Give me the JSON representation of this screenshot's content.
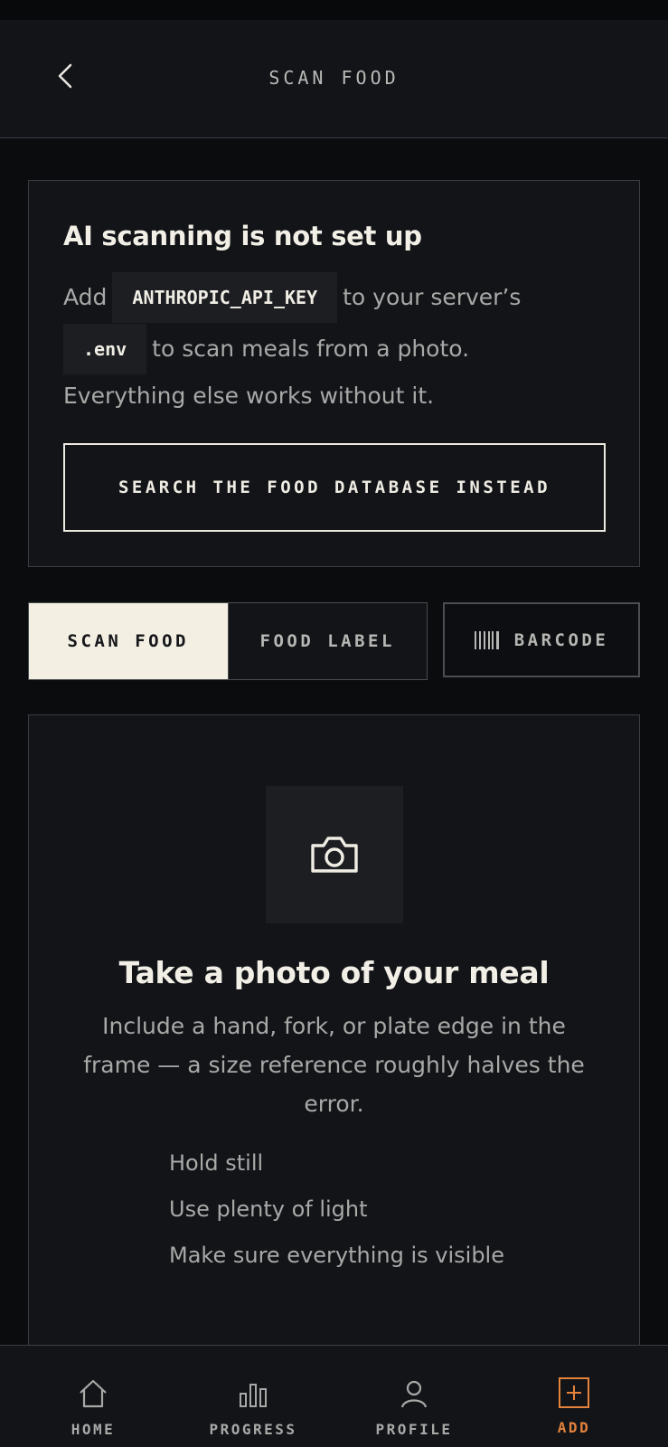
{
  "header": {
    "title": "SCAN FOOD"
  },
  "notice": {
    "title": "AI scanning is not set up",
    "add_word": "Add",
    "api_key_code": "ANTHROPIC_API_KEY",
    "after_key": "to your server’s",
    "env_code": ".env",
    "after_env": "to scan meals from a photo.",
    "line3": "Everything else works without it.",
    "button_label": "SEARCH THE FOOD DATABASE INSTEAD"
  },
  "modes": {
    "scan_food": "SCAN FOOD",
    "food_label": "FOOD LABEL",
    "barcode": "BARCODE"
  },
  "photo": {
    "title": "Take a photo of your meal",
    "subtitle": "Include a hand, fork, or plate edge in the frame — a size reference roughly halves the error.",
    "tips": [
      "Hold still",
      "Use plenty of light",
      "Make sure everything is visible"
    ]
  },
  "nav": {
    "home": "HOME",
    "progress": "PROGRESS",
    "profile": "PROFILE",
    "add": "ADD"
  },
  "colors": {
    "background": "#0b0c0e",
    "card": "#121418",
    "accent": "#e4823b",
    "active_segment": "#f3efe3"
  }
}
